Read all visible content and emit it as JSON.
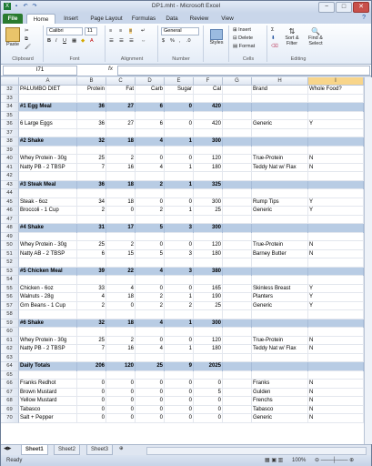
{
  "window": {
    "title": "DP1.mht - Microsoft Excel",
    "quick_access": [
      "save-icon",
      "undo-icon",
      "redo-icon"
    ],
    "controls": [
      "−",
      "□",
      "✕"
    ]
  },
  "ribbon_tabs": [
    "File",
    "Home",
    "Insert",
    "Page Layout",
    "Formulas",
    "Data",
    "Review",
    "View"
  ],
  "ribbon": {
    "clipboard": {
      "paste": "Paste",
      "label": "Clipboard"
    },
    "font": {
      "name": "Calibri",
      "size": "11",
      "label": "Font"
    },
    "alignment": {
      "label": "Alignment"
    },
    "number": {
      "format": "General",
      "label": "Number"
    },
    "styles": {
      "button": "Styles"
    },
    "cells": {
      "insert": "Insert",
      "delete": "Delete",
      "format": "Format",
      "label": "Cells"
    },
    "editing": {
      "sort": "Sort & Filter",
      "find": "Find & Select",
      "label": "Editing"
    }
  },
  "formula_bar": {
    "name_box": "I71",
    "fx": "fx",
    "content": ""
  },
  "columns": [
    "A",
    "B",
    "C",
    "D",
    "E",
    "F",
    "G",
    "H",
    "I"
  ],
  "selected_column": "I",
  "rows": [
    {
      "n": "32",
      "hl": false,
      "c": [
        "PALUMBO DIET",
        "Protein",
        "Fat",
        "Carb",
        "Sugar",
        "Cal",
        "",
        "Brand",
        "Whole Food?"
      ]
    },
    {
      "n": "33",
      "hl": false,
      "c": [
        "",
        "",
        "",
        "",
        "",
        "",
        "",
        "",
        ""
      ]
    },
    {
      "n": "34",
      "hl": true,
      "c": [
        "#1 Egg Meal",
        "36",
        "27",
        "6",
        "0",
        "420",
        "",
        "",
        ""
      ]
    },
    {
      "n": "35",
      "hl": false,
      "c": [
        "",
        "",
        "",
        "",
        "",
        "",
        "",
        "",
        ""
      ]
    },
    {
      "n": "36",
      "hl": false,
      "c": [
        "6 Large Eggs",
        "36",
        "27",
        "6",
        "0",
        "420",
        "",
        "Generic",
        "Y"
      ]
    },
    {
      "n": "37",
      "hl": false,
      "c": [
        "",
        "",
        "",
        "",
        "",
        "",
        "",
        "",
        ""
      ]
    },
    {
      "n": "38",
      "hl": true,
      "c": [
        "#2 Shake",
        "32",
        "18",
        "4",
        "1",
        "300",
        "",
        "",
        ""
      ]
    },
    {
      "n": "39",
      "hl": false,
      "c": [
        "",
        "",
        "",
        "",
        "",
        "",
        "",
        "",
        ""
      ]
    },
    {
      "n": "40",
      "hl": false,
      "c": [
        "Whey Protein - 30g",
        "25",
        "2",
        "0",
        "0",
        "120",
        "",
        "True-Protein",
        "N"
      ]
    },
    {
      "n": "41",
      "hl": false,
      "c": [
        "Natty PB - 2 TBSP",
        "7",
        "16",
        "4",
        "1",
        "180",
        "",
        "Teddy Nat w/ Flax",
        "N"
      ]
    },
    {
      "n": "42",
      "hl": false,
      "c": [
        "",
        "",
        "",
        "",
        "",
        "",
        "",
        "",
        ""
      ]
    },
    {
      "n": "43",
      "hl": true,
      "c": [
        "#3 Steak Meal",
        "36",
        "18",
        "2",
        "1",
        "325",
        "",
        "",
        ""
      ]
    },
    {
      "n": "44",
      "hl": false,
      "c": [
        "",
        "",
        "",
        "",
        "",
        "",
        "",
        "",
        ""
      ]
    },
    {
      "n": "45",
      "hl": false,
      "c": [
        "Steak - 6oz",
        "34",
        "18",
        "0",
        "0",
        "300",
        "",
        "Rump Tips",
        "Y"
      ]
    },
    {
      "n": "46",
      "hl": false,
      "c": [
        "Broccoli - 1 Cup",
        "2",
        "0",
        "2",
        "1",
        "25",
        "",
        "Generic",
        "Y"
      ]
    },
    {
      "n": "47",
      "hl": false,
      "c": [
        "",
        "",
        "",
        "",
        "",
        "",
        "",
        "",
        ""
      ]
    },
    {
      "n": "48",
      "hl": true,
      "c": [
        "#4 Shake",
        "31",
        "17",
        "5",
        "3",
        "300",
        "",
        "",
        ""
      ]
    },
    {
      "n": "49",
      "hl": false,
      "c": [
        "",
        "",
        "",
        "",
        "",
        "",
        "",
        "",
        ""
      ]
    },
    {
      "n": "50",
      "hl": false,
      "c": [
        "Whey Protein - 30g",
        "25",
        "2",
        "0",
        "0",
        "120",
        "",
        "True-Protein",
        "N"
      ]
    },
    {
      "n": "51",
      "hl": false,
      "c": [
        "Natty AB - 2 TBSP",
        "6",
        "15",
        "5",
        "3",
        "180",
        "",
        "Barney Butter",
        "N"
      ]
    },
    {
      "n": "52",
      "hl": false,
      "c": [
        "",
        "",
        "",
        "",
        "",
        "",
        "",
        "",
        ""
      ]
    },
    {
      "n": "53",
      "hl": true,
      "c": [
        "#5 Chicken Meal",
        "39",
        "22",
        "4",
        "3",
        "380",
        "",
        "",
        ""
      ]
    },
    {
      "n": "54",
      "hl": false,
      "c": [
        "",
        "",
        "",
        "",
        "",
        "",
        "",
        "",
        ""
      ]
    },
    {
      "n": "55",
      "hl": false,
      "c": [
        "Chicken - 6oz",
        "33",
        "4",
        "0",
        "0",
        "165",
        "",
        "Skinless Breast",
        "Y"
      ]
    },
    {
      "n": "56",
      "hl": false,
      "c": [
        "Walnuts - 28g",
        "4",
        "18",
        "2",
        "1",
        "190",
        "",
        "Planters",
        "Y"
      ]
    },
    {
      "n": "57",
      "hl": false,
      "c": [
        "Grn Beans - 1 Cup",
        "2",
        "0",
        "2",
        "2",
        "25",
        "",
        "Generic",
        "Y"
      ]
    },
    {
      "n": "58",
      "hl": false,
      "c": [
        "",
        "",
        "",
        "",
        "",
        "",
        "",
        "",
        ""
      ]
    },
    {
      "n": "59",
      "hl": true,
      "c": [
        "#6 Shake",
        "32",
        "18",
        "4",
        "1",
        "300",
        "",
        "",
        ""
      ]
    },
    {
      "n": "60",
      "hl": false,
      "c": [
        "",
        "",
        "",
        "",
        "",
        "",
        "",
        "",
        ""
      ]
    },
    {
      "n": "61",
      "hl": false,
      "c": [
        "Whey Protein - 30g",
        "25",
        "2",
        "0",
        "0",
        "120",
        "",
        "True-Protein",
        "N"
      ]
    },
    {
      "n": "62",
      "hl": false,
      "c": [
        "Natty PB - 2 TBSP",
        "7",
        "16",
        "4",
        "1",
        "180",
        "",
        "Teddy Nat w/ Flax",
        "N"
      ]
    },
    {
      "n": "63",
      "hl": false,
      "c": [
        "",
        "",
        "",
        "",
        "",
        "",
        "",
        "",
        ""
      ]
    },
    {
      "n": "64",
      "hl": true,
      "c": [
        "Daily Totals",
        "206",
        "120",
        "25",
        "9",
        "2025",
        "",
        "",
        ""
      ]
    },
    {
      "n": "65",
      "hl": false,
      "c": [
        "",
        "",
        "",
        "",
        "",
        "",
        "",
        "",
        ""
      ]
    },
    {
      "n": "66",
      "hl": false,
      "c": [
        "Franks Redhot",
        "0",
        "0",
        "0",
        "0",
        "0",
        "",
        "Franks",
        "N"
      ]
    },
    {
      "n": "67",
      "hl": false,
      "c": [
        "Brown Mustard",
        "0",
        "0",
        "0",
        "0",
        "5",
        "",
        "Gulden",
        "N"
      ]
    },
    {
      "n": "68",
      "hl": false,
      "c": [
        "Yellow Mustard",
        "0",
        "0",
        "0",
        "0",
        "0",
        "",
        "Frenchs",
        "N"
      ]
    },
    {
      "n": "69",
      "hl": false,
      "c": [
        "Tabasco",
        "0",
        "0",
        "0",
        "0",
        "0",
        "",
        "Tabasco",
        "N"
      ]
    },
    {
      "n": "70",
      "hl": false,
      "c": [
        "Salt + Pepper",
        "0",
        "0",
        "0",
        "0",
        "0",
        "",
        "Generic",
        "N"
      ]
    }
  ],
  "sheets": [
    "Sheet1",
    "Sheet2",
    "Sheet3"
  ],
  "active_sheet": "Sheet1",
  "status": {
    "ready": "Ready",
    "zoom": "100%"
  }
}
